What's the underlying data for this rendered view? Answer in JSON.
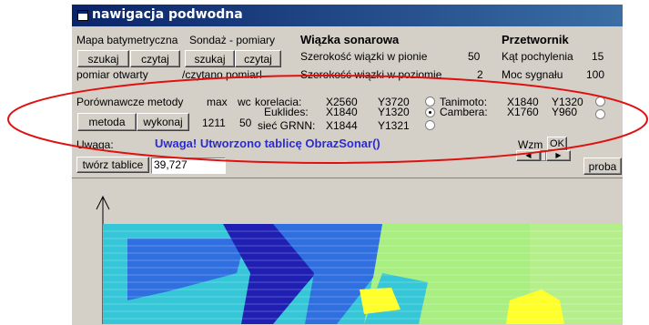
{
  "window": {
    "title": "nawigacja podwodna"
  },
  "map": {
    "label_bathymetry": "Mapa batymetryczna",
    "label_sounding": "Sondaż - pomiary",
    "btn_search_1": "szukaj",
    "btn_read_1": "czytaj",
    "btn_search_2": "szukaj",
    "btn_read_2": "czytaj",
    "status_measure_open": "pomiar otwarty",
    "status_measure_read": "/czytano pomiar!"
  },
  "sonar": {
    "heading": "Wiązka sonarowa",
    "vertical_label": "Szerokość wiązki w  pionie",
    "vertical_value": "50",
    "horizontal_label": "Szerokość wiązki w  poziomie",
    "horizontal_value": "2"
  },
  "transducer": {
    "heading": "Przetwornik",
    "tilt_label": "Kąt pochylenia",
    "tilt_value": "15",
    "power_label": "Moc sygnału",
    "power_value": "100"
  },
  "methods": {
    "label": "Porównawcze metody",
    "max_label": "max",
    "wc_label": "wc",
    "max_value": "1211",
    "wc_value": "50",
    "btn_method": "metoda",
    "btn_execute": "wykonaj",
    "korelacia_label": "korelacia:",
    "korelacia_x": "X2560",
    "korelacia_y": "Y3720",
    "euklides_label": "Euklides:",
    "euklides_x": "X1840",
    "euklides_y": "Y1320",
    "grnn_label": "sieć GRNN:",
    "grnn_x": "X1844",
    "grnn_y": "Y1321",
    "tanimoto_label": "Tanimoto:",
    "tanimoto_x": "X1840",
    "tanimoto_y": "Y1320",
    "cambera_label": "Cambera:",
    "cambera_x": "X1760",
    "cambera_y": "Y960"
  },
  "notice": {
    "label": "Uwaga:",
    "message": "Uwaga! Utworzono tablicę ObrazSonar()"
  },
  "controls": {
    "wzm_label": "Wzm",
    "ok_button": "OK",
    "create_table_button": "twórz tablice",
    "timer_value": "39,727",
    "proba_button": "proba"
  },
  "colors": {
    "deep": "#1f1fb4",
    "mid_blue": "#2f6fe0",
    "cyan": "#35c6d8",
    "green": "#a8ee80",
    "yellow": "#ffff2a",
    "annotation": "#e01010"
  }
}
